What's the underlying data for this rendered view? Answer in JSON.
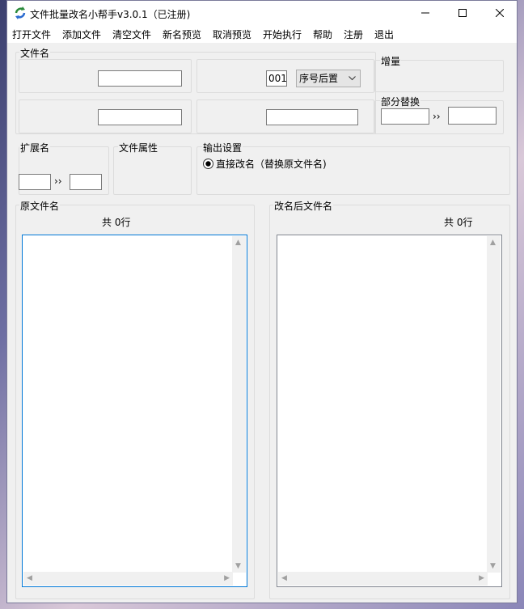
{
  "window": {
    "title": "文件批量改名小帮手v3.0.1（已注册)",
    "controls": {
      "minimize": "—",
      "maximize": "☐",
      "close": "✕"
    }
  },
  "menu": [
    "打开文件",
    "添加文件",
    "清空文件",
    "新名预览",
    "取消预览",
    "开始执行",
    "帮助",
    "注册",
    "退出"
  ],
  "filename_group": {
    "label": "文件名",
    "row1_input": "",
    "serial_value": "001",
    "serial_position": "序号后置",
    "row2_input_left": "",
    "row2_input_right": ""
  },
  "increment_group": {
    "label": "增量"
  },
  "partial_replace": {
    "label": "部分替换",
    "from": "",
    "arrow": "››",
    "to": ""
  },
  "extension_group": {
    "label": "扩展名",
    "from": "",
    "arrow": "››",
    "to": ""
  },
  "attributes_group": {
    "label": "文件属性"
  },
  "output_group": {
    "label": "输出设置",
    "radio_label": "直接改名（替换原文件名)",
    "radio_checked": true
  },
  "original_list": {
    "label": "原文件名",
    "count_text": "共 0行"
  },
  "renamed_list": {
    "label": "改名后文件名",
    "count_text": "共 0行"
  }
}
